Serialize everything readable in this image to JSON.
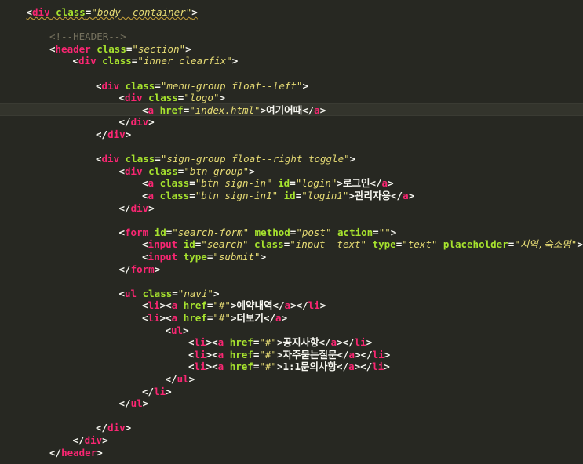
{
  "editor": {
    "top_fragment": "--->",
    "lines": [
      {
        "indent": 1,
        "squiggle": true,
        "tokens": [
          [
            "br",
            "<"
          ],
          [
            "tag",
            "div"
          ],
          [
            "sp",
            " "
          ],
          [
            "attr",
            "class"
          ],
          [
            "eq",
            "="
          ],
          [
            "val",
            "\"body  container\""
          ],
          [
            "br",
            ">"
          ]
        ]
      },
      {
        "indent": 0,
        "tokens": []
      },
      {
        "indent": 2,
        "tokens": [
          [
            "comment",
            "<!--HEADER-->"
          ]
        ]
      },
      {
        "indent": 2,
        "tokens": [
          [
            "br",
            "<"
          ],
          [
            "tag",
            "header"
          ],
          [
            "sp",
            " "
          ],
          [
            "attr",
            "class"
          ],
          [
            "eq",
            "="
          ],
          [
            "val",
            "\"section\""
          ],
          [
            "br",
            ">"
          ]
        ]
      },
      {
        "indent": 3,
        "tokens": [
          [
            "br",
            "<"
          ],
          [
            "tag",
            "div"
          ],
          [
            "sp",
            " "
          ],
          [
            "attr",
            "class"
          ],
          [
            "eq",
            "="
          ],
          [
            "val",
            "\"inner clearfix\""
          ],
          [
            "br",
            ">"
          ]
        ]
      },
      {
        "indent": 0,
        "tokens": []
      },
      {
        "indent": 4,
        "tokens": [
          [
            "br",
            "<"
          ],
          [
            "tag",
            "div"
          ],
          [
            "sp",
            " "
          ],
          [
            "attr",
            "class"
          ],
          [
            "eq",
            "="
          ],
          [
            "val",
            "\"menu-group float--left\""
          ],
          [
            "br",
            ">"
          ]
        ]
      },
      {
        "indent": 5,
        "tokens": [
          [
            "br",
            "<"
          ],
          [
            "tag",
            "div"
          ],
          [
            "sp",
            " "
          ],
          [
            "attr",
            "class"
          ],
          [
            "eq",
            "="
          ],
          [
            "val",
            "\"logo\""
          ],
          [
            "br",
            ">"
          ]
        ]
      },
      {
        "indent": 6,
        "current": true,
        "tokens": [
          [
            "br",
            "<"
          ],
          [
            "tag",
            "a"
          ],
          [
            "sp",
            " "
          ],
          [
            "attr",
            "href"
          ],
          [
            "eq",
            "="
          ],
          [
            "val",
            "\"index.html\""
          ],
          [
            "br",
            ">"
          ],
          [
            "text",
            "여기어때"
          ],
          [
            "br",
            "</"
          ],
          [
            "tag",
            "a"
          ],
          [
            "br",
            ">"
          ]
        ]
      },
      {
        "indent": 5,
        "tokens": [
          [
            "br",
            "</"
          ],
          [
            "tag",
            "div"
          ],
          [
            "br",
            ">"
          ]
        ]
      },
      {
        "indent": 4,
        "tokens": [
          [
            "br",
            "</"
          ],
          [
            "tag",
            "div"
          ],
          [
            "br",
            ">"
          ]
        ]
      },
      {
        "indent": 0,
        "tokens": []
      },
      {
        "indent": 4,
        "tokens": [
          [
            "br",
            "<"
          ],
          [
            "tag",
            "div"
          ],
          [
            "sp",
            " "
          ],
          [
            "attr",
            "class"
          ],
          [
            "eq",
            "="
          ],
          [
            "val",
            "\"sign-group float--right toggle\""
          ],
          [
            "br",
            ">"
          ]
        ]
      },
      {
        "indent": 5,
        "tokens": [
          [
            "br",
            "<"
          ],
          [
            "tag",
            "div"
          ],
          [
            "sp",
            " "
          ],
          [
            "attr",
            "class"
          ],
          [
            "eq",
            "="
          ],
          [
            "val",
            "\"btn-group\""
          ],
          [
            "br",
            ">"
          ]
        ]
      },
      {
        "indent": 6,
        "tokens": [
          [
            "br",
            "<"
          ],
          [
            "tag",
            "a"
          ],
          [
            "sp",
            " "
          ],
          [
            "attr",
            "class"
          ],
          [
            "eq",
            "="
          ],
          [
            "val",
            "\"btn sign-in\""
          ],
          [
            "sp",
            " "
          ],
          [
            "attr",
            "id"
          ],
          [
            "eq",
            "="
          ],
          [
            "val",
            "\"login\""
          ],
          [
            "br",
            ">"
          ],
          [
            "text",
            "로그인"
          ],
          [
            "br",
            "</"
          ],
          [
            "tag",
            "a"
          ],
          [
            "br",
            ">"
          ]
        ]
      },
      {
        "indent": 6,
        "tokens": [
          [
            "br",
            "<"
          ],
          [
            "tag",
            "a"
          ],
          [
            "sp",
            " "
          ],
          [
            "attr",
            "class"
          ],
          [
            "eq",
            "="
          ],
          [
            "val",
            "\"btn sign-in1\""
          ],
          [
            "sp",
            " "
          ],
          [
            "attr",
            "id"
          ],
          [
            "eq",
            "="
          ],
          [
            "val",
            "\"login1\""
          ],
          [
            "br",
            ">"
          ],
          [
            "text",
            "관리자용"
          ],
          [
            "br",
            "</"
          ],
          [
            "tag",
            "a"
          ],
          [
            "br",
            ">"
          ]
        ]
      },
      {
        "indent": 5,
        "tokens": [
          [
            "br",
            "</"
          ],
          [
            "tag",
            "div"
          ],
          [
            "br",
            ">"
          ]
        ]
      },
      {
        "indent": 0,
        "tokens": []
      },
      {
        "indent": 5,
        "tokens": [
          [
            "br",
            "<"
          ],
          [
            "tag",
            "form"
          ],
          [
            "sp",
            " "
          ],
          [
            "attr",
            "id"
          ],
          [
            "eq",
            "="
          ],
          [
            "val",
            "\"search-form\""
          ],
          [
            "sp",
            " "
          ],
          [
            "attr",
            "method"
          ],
          [
            "eq",
            "="
          ],
          [
            "val",
            "\"post\""
          ],
          [
            "sp",
            " "
          ],
          [
            "attr",
            "action"
          ],
          [
            "eq",
            "="
          ],
          [
            "val",
            "\"\""
          ],
          [
            "br",
            ">"
          ]
        ]
      },
      {
        "indent": 6,
        "tokens": [
          [
            "br",
            "<"
          ],
          [
            "tag",
            "input"
          ],
          [
            "sp",
            " "
          ],
          [
            "attr",
            "id"
          ],
          [
            "eq",
            "="
          ],
          [
            "val",
            "\"search\""
          ],
          [
            "sp",
            " "
          ],
          [
            "attr",
            "class"
          ],
          [
            "eq",
            "="
          ],
          [
            "val",
            "\"input--text\""
          ],
          [
            "sp",
            " "
          ],
          [
            "attr",
            "type"
          ],
          [
            "eq",
            "="
          ],
          [
            "val",
            "\"text\""
          ],
          [
            "sp",
            " "
          ],
          [
            "attr",
            "placeholder"
          ],
          [
            "eq",
            "="
          ],
          [
            "val",
            "\"지역,숙소명\""
          ],
          [
            "br",
            ">"
          ]
        ]
      },
      {
        "indent": 6,
        "tokens": [
          [
            "br",
            "<"
          ],
          [
            "tag",
            "input"
          ],
          [
            "sp",
            " "
          ],
          [
            "attr",
            "type"
          ],
          [
            "eq",
            "="
          ],
          [
            "val",
            "\"submit\""
          ],
          [
            "br",
            ">"
          ]
        ]
      },
      {
        "indent": 5,
        "tokens": [
          [
            "br",
            "</"
          ],
          [
            "tag",
            "form"
          ],
          [
            "br",
            ">"
          ]
        ]
      },
      {
        "indent": 0,
        "tokens": []
      },
      {
        "indent": 5,
        "tokens": [
          [
            "br",
            "<"
          ],
          [
            "tag",
            "ul"
          ],
          [
            "sp",
            " "
          ],
          [
            "attr",
            "class"
          ],
          [
            "eq",
            "="
          ],
          [
            "val",
            "\"navi\""
          ],
          [
            "br",
            ">"
          ]
        ]
      },
      {
        "indent": 6,
        "tokens": [
          [
            "br",
            "<"
          ],
          [
            "tag",
            "li"
          ],
          [
            "br",
            "><"
          ],
          [
            "tag",
            "a"
          ],
          [
            "sp",
            " "
          ],
          [
            "attr",
            "href"
          ],
          [
            "eq",
            "="
          ],
          [
            "val",
            "\"#\""
          ],
          [
            "br",
            ">"
          ],
          [
            "text",
            "예약내역"
          ],
          [
            "br",
            "</"
          ],
          [
            "tag",
            "a"
          ],
          [
            "br",
            "></"
          ],
          [
            "tag",
            "li"
          ],
          [
            "br",
            ">"
          ]
        ]
      },
      {
        "indent": 6,
        "tokens": [
          [
            "br",
            "<"
          ],
          [
            "tag",
            "li"
          ],
          [
            "br",
            "><"
          ],
          [
            "tag",
            "a"
          ],
          [
            "sp",
            " "
          ],
          [
            "attr",
            "href"
          ],
          [
            "eq",
            "="
          ],
          [
            "val",
            "\"#\""
          ],
          [
            "br",
            ">"
          ],
          [
            "text",
            "더보기"
          ],
          [
            "br",
            "</"
          ],
          [
            "tag",
            "a"
          ],
          [
            "br",
            ">"
          ]
        ]
      },
      {
        "indent": 7,
        "tokens": [
          [
            "br",
            "<"
          ],
          [
            "tag",
            "ul"
          ],
          [
            "br",
            ">"
          ]
        ]
      },
      {
        "indent": 8,
        "tokens": [
          [
            "br",
            "<"
          ],
          [
            "tag",
            "li"
          ],
          [
            "br",
            "><"
          ],
          [
            "tag",
            "a"
          ],
          [
            "sp",
            " "
          ],
          [
            "attr",
            "href"
          ],
          [
            "eq",
            "="
          ],
          [
            "val",
            "\"#\""
          ],
          [
            "br",
            ">"
          ],
          [
            "text",
            "공지사항"
          ],
          [
            "br",
            "</"
          ],
          [
            "tag",
            "a"
          ],
          [
            "br",
            "></"
          ],
          [
            "tag",
            "li"
          ],
          [
            "br",
            ">"
          ]
        ]
      },
      {
        "indent": 8,
        "tokens": [
          [
            "br",
            "<"
          ],
          [
            "tag",
            "li"
          ],
          [
            "br",
            "><"
          ],
          [
            "tag",
            "a"
          ],
          [
            "sp",
            " "
          ],
          [
            "attr",
            "href"
          ],
          [
            "eq",
            "="
          ],
          [
            "val",
            "\"#\""
          ],
          [
            "br",
            ">"
          ],
          [
            "text",
            "자주묻는질문"
          ],
          [
            "br",
            "</"
          ],
          [
            "tag",
            "a"
          ],
          [
            "br",
            "></"
          ],
          [
            "tag",
            "li"
          ],
          [
            "br",
            ">"
          ]
        ]
      },
      {
        "indent": 8,
        "tokens": [
          [
            "br",
            "<"
          ],
          [
            "tag",
            "li"
          ],
          [
            "br",
            "><"
          ],
          [
            "tag",
            "a"
          ],
          [
            "sp",
            " "
          ],
          [
            "attr",
            "href"
          ],
          [
            "eq",
            "="
          ],
          [
            "val",
            "\"#\""
          ],
          [
            "br",
            ">"
          ],
          [
            "text",
            "1:1문의사항"
          ],
          [
            "br",
            "</"
          ],
          [
            "tag",
            "a"
          ],
          [
            "br",
            "></"
          ],
          [
            "tag",
            "li"
          ],
          [
            "br",
            ">"
          ]
        ]
      },
      {
        "indent": 7,
        "tokens": [
          [
            "br",
            "</"
          ],
          [
            "tag",
            "ul"
          ],
          [
            "br",
            ">"
          ]
        ]
      },
      {
        "indent": 6,
        "tokens": [
          [
            "br",
            "</"
          ],
          [
            "tag",
            "li"
          ],
          [
            "br",
            ">"
          ]
        ]
      },
      {
        "indent": 5,
        "tokens": [
          [
            "br",
            "</"
          ],
          [
            "tag",
            "ul"
          ],
          [
            "br",
            ">"
          ]
        ]
      },
      {
        "indent": 0,
        "tokens": []
      },
      {
        "indent": 4,
        "tokens": [
          [
            "br",
            "</"
          ],
          [
            "tag",
            "div"
          ],
          [
            "br",
            ">"
          ]
        ]
      },
      {
        "indent": 3,
        "tokens": [
          [
            "br",
            "</"
          ],
          [
            "tag",
            "div"
          ],
          [
            "br",
            ">"
          ]
        ]
      },
      {
        "indent": 2,
        "tokens": [
          [
            "br",
            "</"
          ],
          [
            "tag",
            "header"
          ],
          [
            "br",
            ">"
          ]
        ]
      }
    ]
  }
}
